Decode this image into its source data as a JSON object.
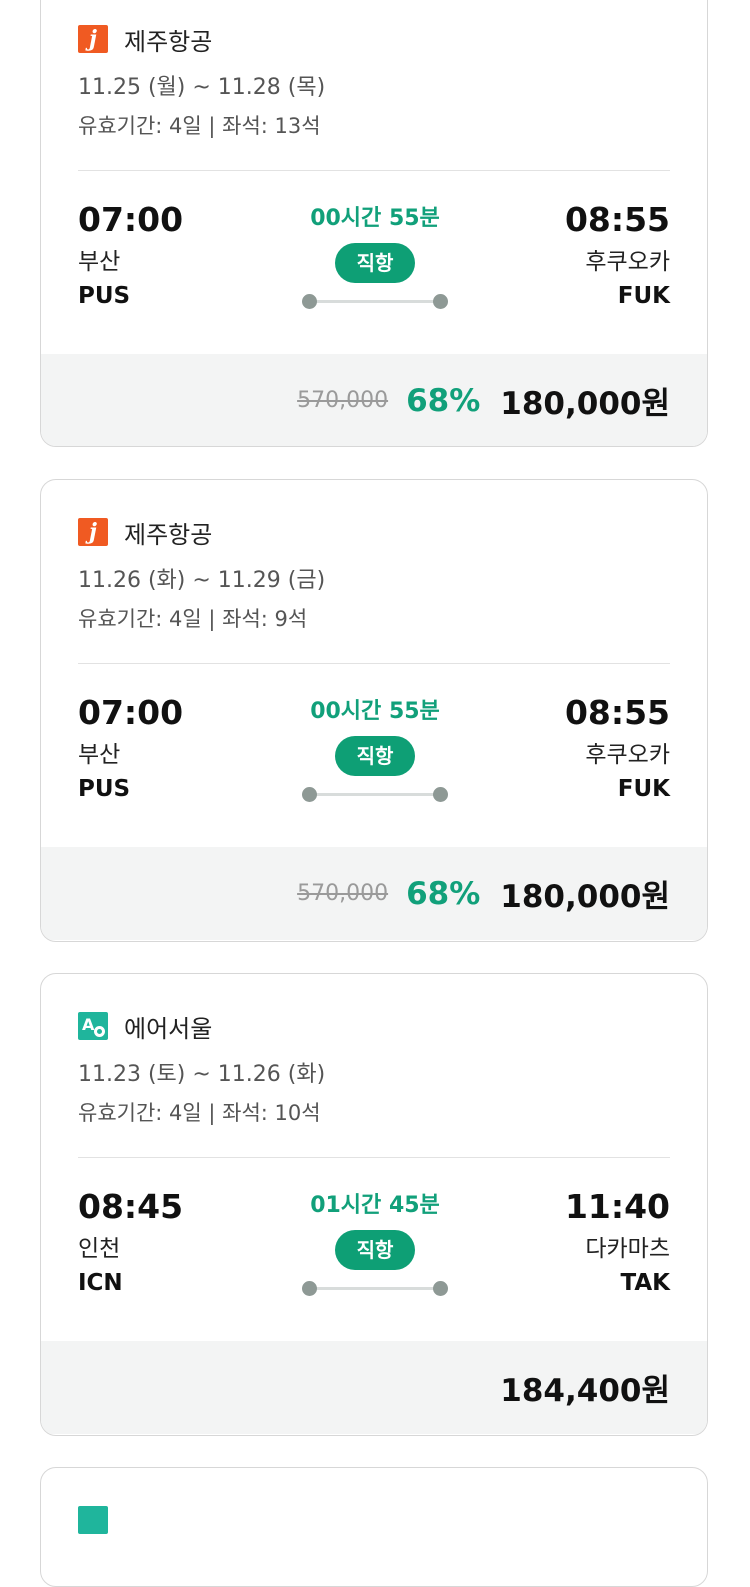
{
  "cards": [
    {
      "airline": "제주항공",
      "dates": "11.25 (월) ~ 11.28 (목)",
      "meta": "유효기간: 4일 | 좌석: 13석",
      "dep_time": "07:00",
      "dep_city": "부산",
      "dep_code": "PUS",
      "duration": "00시간 55분",
      "type": "직항",
      "arr_time": "08:55",
      "arr_city": "후쿠오카",
      "arr_code": "FUK",
      "original_price": "570,000",
      "discount": "68%",
      "price": "180,000원"
    },
    {
      "airline": "제주항공",
      "dates": "11.26 (화) ~ 11.29 (금)",
      "meta": "유효기간: 4일 | 좌석: 9석",
      "dep_time": "07:00",
      "dep_city": "부산",
      "dep_code": "PUS",
      "duration": "00시간 55분",
      "type": "직항",
      "arr_time": "08:55",
      "arr_city": "후쿠오카",
      "arr_code": "FUK",
      "original_price": "570,000",
      "discount": "68%",
      "price": "180,000원"
    },
    {
      "airline": "에어서울",
      "dates": "11.23 (토) ~ 11.26 (화)",
      "meta": "유효기간: 4일 | 좌석: 10석",
      "dep_time": "08:45",
      "dep_city": "인천",
      "dep_code": "ICN",
      "duration": "01시간 45분",
      "type": "직항",
      "arr_time": "11:40",
      "arr_city": "다카마츠",
      "arr_code": "TAK",
      "original_price": "",
      "discount": "",
      "price": "184,400원"
    }
  ],
  "logo_text": {
    "jeju": "j",
    "airseoul": "A"
  },
  "colors": {
    "accent": "#11a07a",
    "badge": "#0e9f75",
    "jeju_logo": "#f05a22",
    "airseoul_logo": "#1fb59c"
  },
  "icons": {
    "jeju": "jeju-air-logo-icon",
    "airseoul": "air-seoul-logo-icon"
  }
}
